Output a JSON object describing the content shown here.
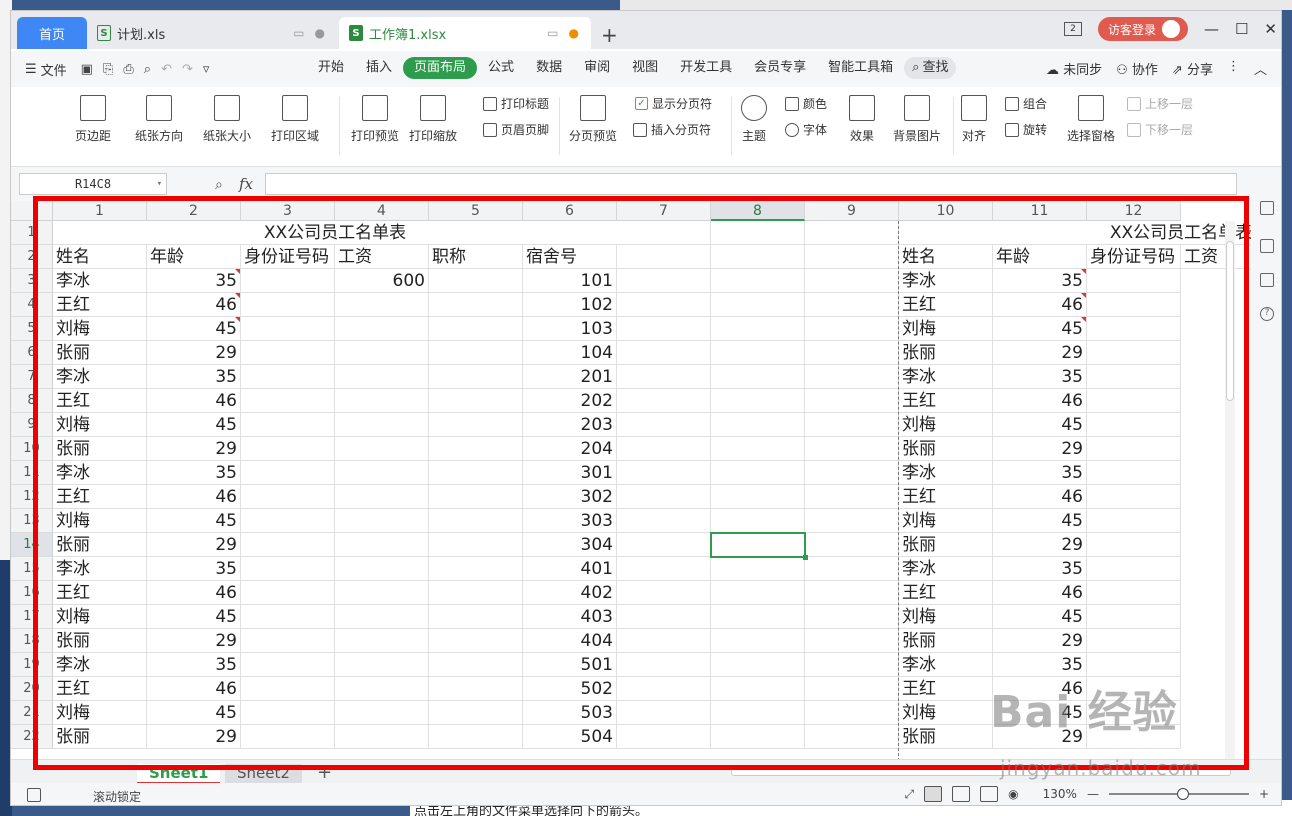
{
  "tabs": [
    {
      "label": "首页"
    },
    {
      "label": "计划.xls"
    },
    {
      "label": "工作簿1.xlsx"
    }
  ],
  "window": {
    "page_count": "2",
    "guest_login": "访客登录"
  },
  "menu": {
    "file": "文件",
    "tabs": [
      "开始",
      "插入",
      "页面布局",
      "公式",
      "数据",
      "审阅",
      "视图",
      "开发工具",
      "会员专享",
      "智能工具箱"
    ],
    "active_tab": "页面布局",
    "search": "查找",
    "sync": "未同步",
    "collab": "协作",
    "share": "分享"
  },
  "ribbon": {
    "margins": "页边距",
    "orientation": "纸张方向",
    "size": "纸张大小",
    "print_area": "打印区域",
    "print_preview": "打印预览",
    "print_scale": "打印缩放",
    "print_titles": "打印标题",
    "header_footer": "页眉页脚",
    "page_break_preview": "分页预览",
    "show_page_breaks": "显示分页符",
    "insert_page_break": "插入分页符",
    "theme": "主题",
    "colors": "颜色",
    "fonts": "字体",
    "effects": "效果",
    "bg_image": "背景图片",
    "align": "对齐",
    "group": "组合",
    "rotate": "旋转",
    "selection_pane": "选择窗格",
    "bring_forward": "上移一层",
    "send_backward": "下移一层"
  },
  "formula_bar": {
    "name_box": "R14C8",
    "fx": "fx",
    "value": ""
  },
  "grid": {
    "columns": [
      "1",
      "2",
      "3",
      "4",
      "5",
      "6",
      "7",
      "8",
      "9",
      "10",
      "11",
      "12"
    ],
    "selected_column": "8",
    "selected_row": "14",
    "title": "XX公司员工名单表",
    "headers": [
      "姓名",
      "年龄",
      "身份证号码",
      "工资",
      "职称",
      "宿舍号"
    ],
    "headers_right": [
      "姓名",
      "年龄",
      "身份证号码",
      "工资"
    ],
    "salary_first": "600",
    "rows": [
      {
        "row": "3",
        "name": "李冰",
        "age": "35",
        "room": "101"
      },
      {
        "row": "4",
        "name": "王红",
        "age": "46",
        "room": "102"
      },
      {
        "row": "5",
        "name": "刘梅",
        "age": "45",
        "room": "103"
      },
      {
        "row": "6",
        "name": "张丽",
        "age": "29",
        "room": "104"
      },
      {
        "row": "7",
        "name": "李冰",
        "age": "35",
        "room": "201"
      },
      {
        "row": "8",
        "name": "王红",
        "age": "46",
        "room": "202"
      },
      {
        "row": "9",
        "name": "刘梅",
        "age": "45",
        "room": "203"
      },
      {
        "row": "10",
        "name": "张丽",
        "age": "29",
        "room": "204"
      },
      {
        "row": "11",
        "name": "李冰",
        "age": "35",
        "room": "301"
      },
      {
        "row": "12",
        "name": "王红",
        "age": "46",
        "room": "302"
      },
      {
        "row": "13",
        "name": "刘梅",
        "age": "45",
        "room": "303"
      },
      {
        "row": "14",
        "name": "张丽",
        "age": "29",
        "room": "304"
      },
      {
        "row": "15",
        "name": "李冰",
        "age": "35",
        "room": "401"
      },
      {
        "row": "16",
        "name": "王红",
        "age": "46",
        "room": "402"
      },
      {
        "row": "17",
        "name": "刘梅",
        "age": "45",
        "room": "403"
      },
      {
        "row": "18",
        "name": "张丽",
        "age": "29",
        "room": "404"
      },
      {
        "row": "19",
        "name": "李冰",
        "age": "35",
        "room": "501"
      },
      {
        "row": "20",
        "name": "王红",
        "age": "46",
        "room": "502"
      },
      {
        "row": "21",
        "name": "刘梅",
        "age": "45",
        "room": "503"
      },
      {
        "row": "22",
        "name": "张丽",
        "age": "29",
        "room": "504"
      }
    ]
  },
  "sheets": [
    "Sheet1",
    "Sheet2"
  ],
  "status": {
    "scroll_lock": "滚动锁定",
    "zoom": "130%"
  },
  "watermark": {
    "line1": "Bai 经验",
    "line2": "jingyan.baidu.com"
  },
  "bg_bottom_text": "点击左上角的文件菜单选择向下的箭头。"
}
